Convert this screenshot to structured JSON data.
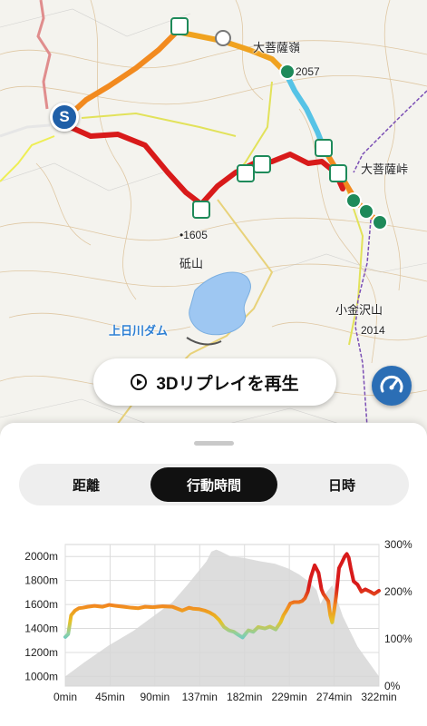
{
  "map": {
    "labels": {
      "peak1": "大菩薩嶺",
      "elev1": "2057",
      "pass": "大菩薩峠",
      "elev2": "•1605",
      "mountain": "砥山",
      "peak2": "小金沢山",
      "elev3": "2014",
      "dam": "上日川ダム"
    },
    "start_marker": "S",
    "replay_button": "3Dリプレイを再生"
  },
  "tabs": {
    "distance": "距離",
    "time": "行動時間",
    "datetime": "日時",
    "active": "time"
  },
  "colors": {
    "route_high": "#d81a1a",
    "route_mid": "#f28a1f",
    "route_low": "#4cc3e8",
    "profile": "#d7d7d7",
    "accent": "#2b6eb5"
  },
  "chart_data": {
    "type": "line",
    "x_ticks": [
      "0min",
      "45min",
      "90min",
      "137min",
      "182min",
      "229min",
      "274min",
      "322min"
    ],
    "xlim": [
      0,
      322
    ],
    "y_left_ticks": [
      "1000m",
      "1200m",
      "1400m",
      "1600m",
      "1800m",
      "2000m"
    ],
    "ylim_left": [
      920,
      2100
    ],
    "y_right_ticks": [
      "0%",
      "100%",
      "200%",
      "300%"
    ],
    "ylim_right": [
      0,
      300
    ],
    "series": [
      {
        "axis": "left",
        "style": "area",
        "x": [
          0,
          20,
          45,
          70,
          90,
          110,
          125,
          137,
          145,
          150,
          155,
          160,
          165,
          170,
          182,
          200,
          215,
          229,
          240,
          250,
          258,
          262,
          268,
          274,
          285,
          300,
          322
        ],
        "y": [
          1000,
          1120,
          1260,
          1380,
          1500,
          1620,
          1760,
          1880,
          1960,
          2040,
          2057,
          2040,
          2020,
          2000,
          1990,
          1960,
          1940,
          1900,
          1850,
          1790,
          1720,
          1605,
          1700,
          1760,
          1500,
          1250,
          1000
        ]
      },
      {
        "axis": "right",
        "style": "pace-line",
        "x": [
          0,
          3,
          6,
          10,
          14,
          18,
          23,
          30,
          38,
          45,
          52,
          60,
          68,
          75,
          82,
          90,
          100,
          110,
          120,
          127,
          131,
          137,
          143,
          148,
          153,
          158,
          163,
          168,
          173,
          178,
          182,
          188,
          193,
          198,
          205,
          210,
          216,
          221,
          224,
          227,
          231,
          235,
          240,
          243,
          246,
          249,
          252,
          256,
          260,
          263,
          265,
          268,
          270,
          272,
          274,
          276,
          278,
          281,
          284,
          287,
          289,
          291,
          293,
          296,
          300,
          304,
          308,
          313,
          317,
          322
        ],
        "y": [
          104,
          110,
          150,
          160,
          165,
          166,
          168,
          170,
          168,
          172,
          170,
          168,
          166,
          165,
          168,
          167,
          169,
          168,
          160,
          166,
          164,
          163,
          160,
          156,
          150,
          140,
          125,
          118,
          115,
          108,
          103,
          118,
          115,
          125,
          122,
          126,
          120,
          135,
          150,
          160,
          175,
          178,
          178,
          180,
          186,
          200,
          230,
          256,
          240,
          205,
          195,
          186,
          180,
          150,
          135,
          160,
          190,
          250,
          262,
          275,
          280,
          272,
          250,
          222,
          215,
          200,
          205,
          200,
          195,
          202
        ]
      }
    ],
    "grid": true
  }
}
